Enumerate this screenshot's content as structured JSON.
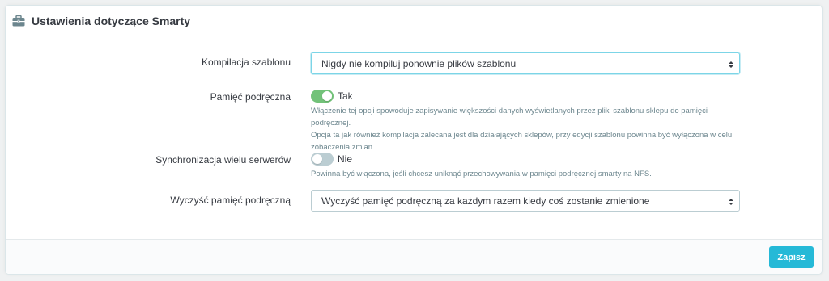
{
  "panel": {
    "title": "Ustawienia dotyczące Smarty",
    "icon": "briefcase-icon"
  },
  "fields": {
    "compilation": {
      "label": "Kompilacja szablonu",
      "value": "Nigdy nie kompiluj ponownie plików szablonu"
    },
    "cache": {
      "label": "Pamięć podręczna",
      "state": "on",
      "value_label": "Tak",
      "help_line1": "Włączenie tej opcji spowoduje zapisywanie większości danych wyświetlanych przez pliki szablonu sklepu do pamięci podręcznej.",
      "help_line2": "Opcja ta jak również kompilacja zalecana jest dla działających sklepów, przy edycji szablonu powinna być wyłączona w celu",
      "help_line3": "zobaczenia zmian."
    },
    "multi_server": {
      "label": "Synchronizacja wielu serwerów",
      "state": "off",
      "value_label": "Nie",
      "help": "Powinna być włączona, jeśli chcesz uniknąć przechowywania w pamięci podręcznej smarty na NFS."
    },
    "clear_cache": {
      "label": "Wyczyść pamięć podręczną",
      "value": "Wyczyść pamięć podręczną za każdym razem kiedy coś zostanie zmienione"
    }
  },
  "footer": {
    "save_label": "Zapisz"
  },
  "colors": {
    "accent": "#25b9d7",
    "switch_on": "#72c279",
    "switch_off": "#bbcdd2"
  }
}
